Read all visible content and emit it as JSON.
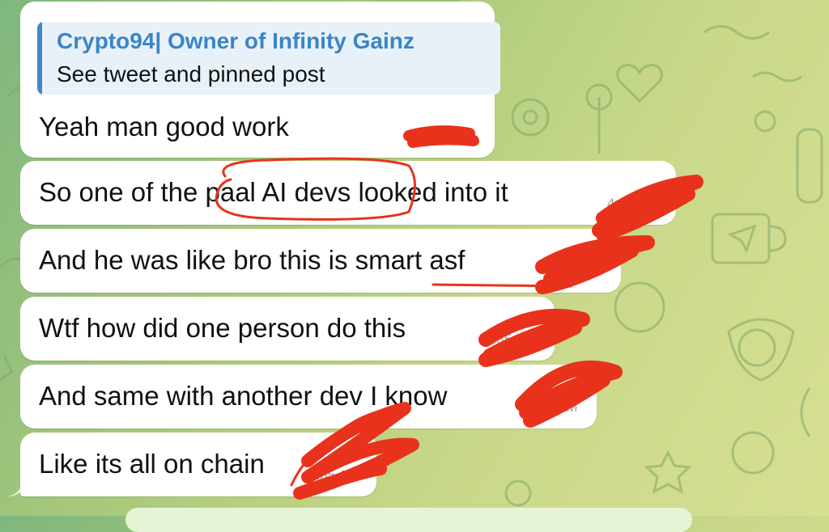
{
  "chat": {
    "reply_preview": {
      "author": "Crypto94| Owner of Infinity Gainz",
      "text": "See tweet and pinned post"
    },
    "messages": [
      {
        "text": "Yeah man good work",
        "time": "4:55 AM"
      },
      {
        "text": "So one of the paal AI devs looked into it",
        "time": "4:55 AM"
      },
      {
        "text": "And he was like bro this is smart asf",
        "time": "4:55 AM"
      },
      {
        "text": "Wtf how did one person do this",
        "time": "4:55 AM"
      },
      {
        "text": "And same with another dev I know",
        "time": "4:55 AM"
      },
      {
        "text": "Like its all on chain",
        "time": "4:55 AM"
      }
    ]
  },
  "colors": {
    "bubble": "#ffffff",
    "reply_accent": "#3f87c8",
    "reply_background": "#e9f1f8",
    "scribble": "#e8321c"
  }
}
